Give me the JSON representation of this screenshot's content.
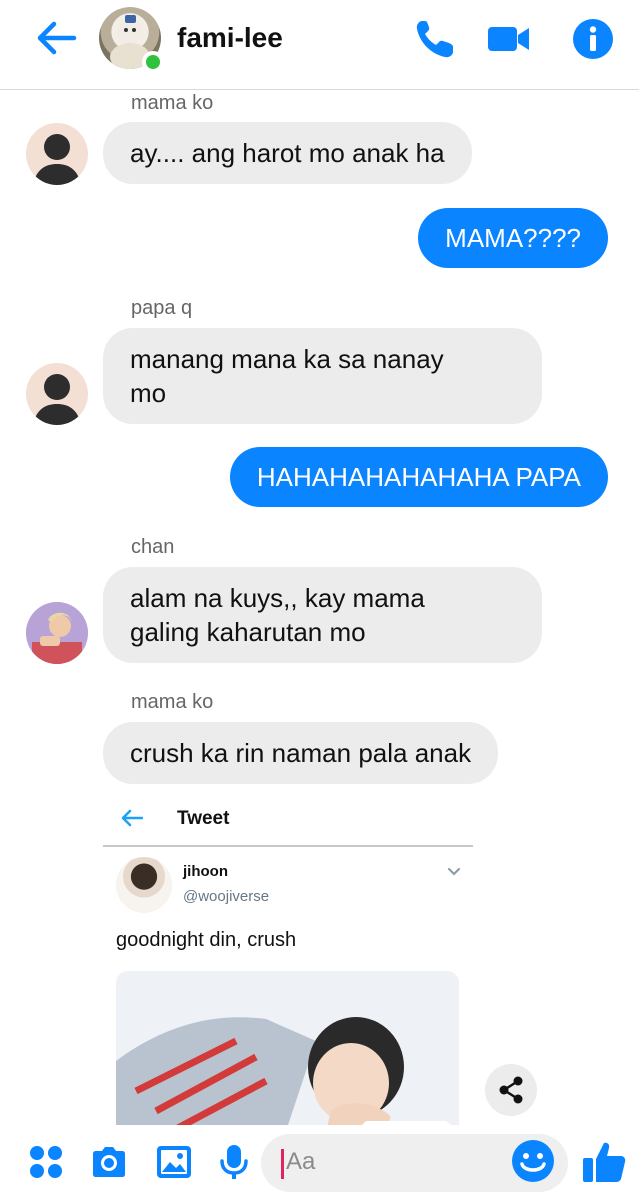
{
  "header": {
    "title": "fami-lee",
    "accent_color": "#0a84ff",
    "online_color": "#2ec23d",
    "icons": [
      "back-arrow-icon",
      "phone-icon",
      "video-camera-icon",
      "info-icon"
    ]
  },
  "messages": [
    {
      "sender": "mama ko",
      "direction": "incoming",
      "text": "ay.... ang harot mo anak ha"
    },
    {
      "direction": "outgoing",
      "text": "MAMA????"
    },
    {
      "sender": "papa q",
      "direction": "incoming",
      "text_line1": "manang mana ka sa nanay",
      "text_line2": "mo"
    },
    {
      "direction": "outgoing",
      "text": "HAHAHAHAHAHAHA PAPA"
    },
    {
      "sender": "chan",
      "direction": "incoming",
      "text_line1": "alam na kuys,, kay mama",
      "text_line2": "galing kaharutan mo"
    },
    {
      "sender": "mama ko",
      "direction": "incoming",
      "text": "crush ka rin naman pala anak"
    }
  ],
  "tweet": {
    "header_label": "Tweet",
    "name": "jihoon",
    "handle": "@woojiverse",
    "text": "goodnight din, crush"
  },
  "composer": {
    "placeholder": "Aa",
    "icons": [
      "more-apps-icon",
      "camera-icon",
      "gallery-icon",
      "microphone-icon",
      "emoji-icon",
      "thumbs-up-icon"
    ]
  }
}
